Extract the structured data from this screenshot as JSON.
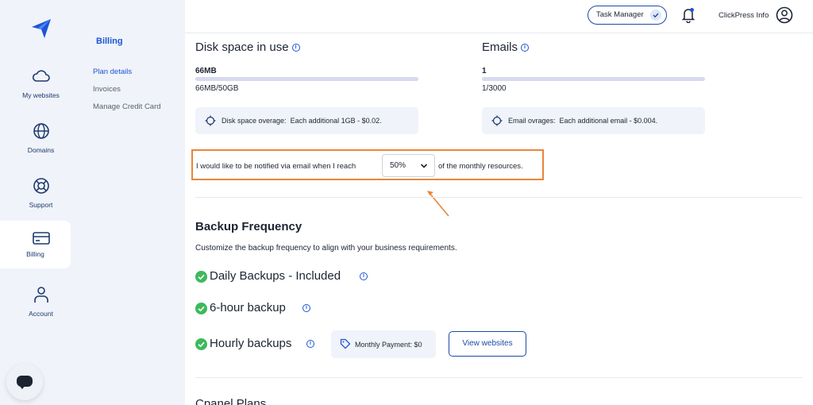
{
  "header": {
    "task_manager_label": "Task Manager",
    "user_name": "ClickPress Info"
  },
  "rail": {
    "items": [
      {
        "label": "My websites",
        "icon": "cloud-icon"
      },
      {
        "label": "Domains",
        "icon": "globe-icon"
      },
      {
        "label": "Support",
        "icon": "lifebuoy-icon"
      },
      {
        "label": "Billing",
        "icon": "credit-card-icon",
        "active": true
      },
      {
        "label": "Account",
        "icon": "user-icon"
      }
    ]
  },
  "subnav": {
    "title": "Billing",
    "links": [
      {
        "label": "Plan details",
        "active": true
      },
      {
        "label": "Invoices"
      },
      {
        "label": "Manage Credit Card"
      }
    ]
  },
  "disk": {
    "title": "Disk space in use",
    "value": "66MB",
    "usage": "66MB/50GB",
    "overage_label": "Disk space overage:",
    "overage_text": "Each additional 1GB - $0.02."
  },
  "emails": {
    "title": "Emails",
    "value": "1",
    "usage": "1/3000",
    "overage_label": "Email ovrages:",
    "overage_text": "Each additional email - $0.004."
  },
  "notify": {
    "prefix": "I would like to be notified via email when I reach",
    "selected": "50%",
    "suffix": "of the monthly resources."
  },
  "backup": {
    "title": "Backup Frequency",
    "description": "Customize the backup frequency to align with your business requirements.",
    "options": [
      {
        "label": "Daily Backups - Included"
      },
      {
        "label": "6-hour backup"
      },
      {
        "label": "Hourly backups"
      }
    ],
    "monthly_payment": "Monthly Payment: $0",
    "view_websites_label": "View websites"
  },
  "next_section_partial": "Cpanel Plans",
  "colors": {
    "accent": "#1a56d6",
    "highlight_border": "#e8863a",
    "success": "#3cb95a",
    "rail_bg": "#f0f3f9"
  }
}
